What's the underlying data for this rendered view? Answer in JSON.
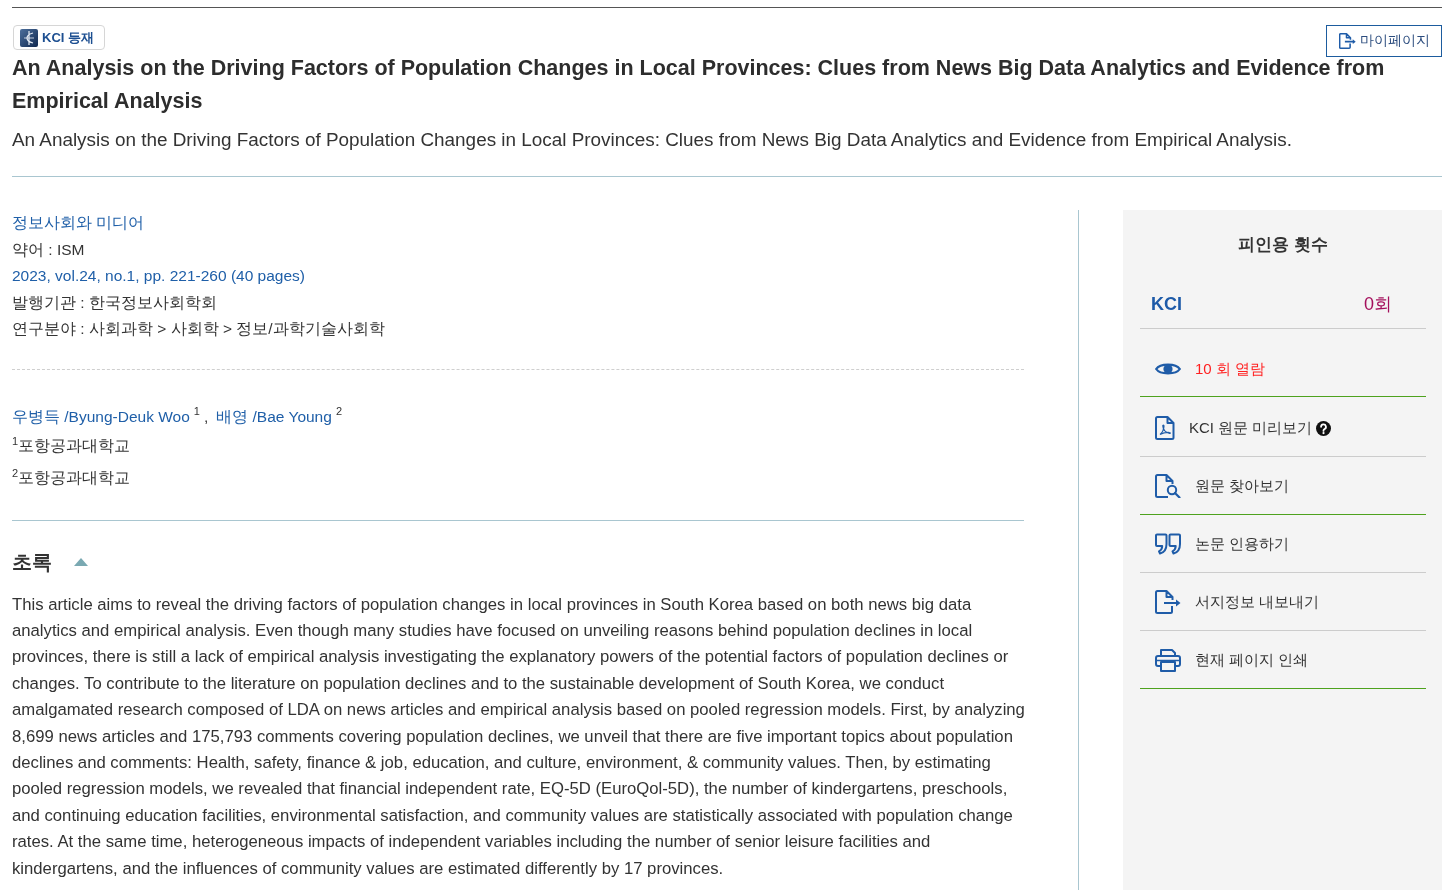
{
  "top_bar": {
    "badge": "KCI 등재",
    "mypage_button": "마이페이지"
  },
  "article": {
    "title": "An Analysis on the Driving Factors of Population Changes in Local Provinces: Clues from News Big Data Analytics and Evidence from Empirical Analysis",
    "subtitle": "An Analysis on the Driving Factors of Population Changes in Local Provinces: Clues from News Big Data Analytics and Evidence from Empirical Analysis."
  },
  "meta": [
    {
      "kind": "link",
      "text": "정보사회와 미디어"
    },
    {
      "kind": "plain",
      "text": "약어 : ISM"
    },
    {
      "kind": "link",
      "text": "2023, vol.24, no.1, pp. 221-260 (40 pages)"
    },
    {
      "kind": "plain",
      "text": "발행기관 : 한국정보사회학회"
    },
    {
      "kind": "plain",
      "text": "연구분야 : 사회과학 > 사회학 > 정보/과학기술사회학"
    }
  ],
  "authors": {
    "items": [
      {
        "name": "우병득 /Byung-Deuk Woo",
        "mark": "1"
      },
      {
        "name": "배영 /Bae Young",
        "mark": "2"
      }
    ],
    "separator": ","
  },
  "affiliations": [
    "$^{1}$포항공과대학교",
    "$^{2}$포항공과대학교"
  ],
  "abstract": {
    "heading": "초록",
    "expanded": true,
    "text": "This article aims to reveal the driving factors of population changes in local provinces in South Korea based on both news big data analytics and empirical analysis. Even though many studies have focused on unveiling reasons behind population declines in local provinces, there is still a lack of empirical analysis investigating the explanatory powers of the potential factors of population declines or changes. To contribute to the literature on population declines and to the sustainable development of South Korea, we conduct amalgamated research composed of LDA on news articles and empirical analysis based on pooled regression models. First, by analyzing 8,699 news articles and 175,793 comments covering population declines, we unveil that there are five important topics about population declines and comments: Health, safety, finance & job, education, and culture, environment, & community values. Then, by estimating pooled regression models, we revealed that financial independent rate, EQ-5D (EuroQol-5D), the number of kindergartens, preschools, and continuing education facilities, environmental satisfaction, and community values are statistically associated with population change rates. At the same time, heterogeneous impacts of independent variables including the number of senior leisure facilities and kindergartens, and the influences of community values are estimated differently by 17 provinces."
  },
  "side_panel": {
    "citations": {
      "title": "피인용 횟수",
      "rows": [
        {
          "source": "KCI",
          "count": "0회"
        }
      ]
    },
    "views": "10 회 열람",
    "action_groups": [
      {
        "items": [
          {
            "kind": "preview",
            "label": "KCI 원문 미리보기",
            "help": true
          },
          {
            "kind": "find",
            "label": "원문 찾아보기",
            "help": false
          }
        ]
      },
      {
        "items": [
          {
            "kind": "cite",
            "label": "논문 인용하기",
            "help": false
          },
          {
            "kind": "export",
            "label": "서지정보 내보내기",
            "help": false
          },
          {
            "kind": "print",
            "label": "현재 페이지 인쇄",
            "help": false
          }
        ]
      }
    ]
  }
}
